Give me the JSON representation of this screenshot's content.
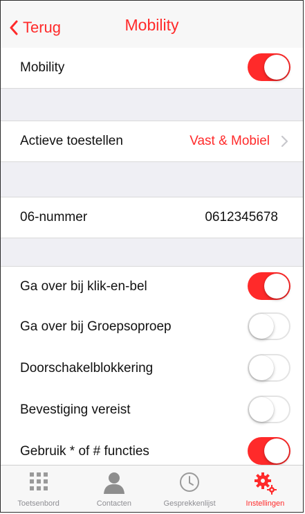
{
  "navbar": {
    "back_label": "Terug",
    "title": "Mobility"
  },
  "rows": {
    "mobility": {
      "label": "Mobility",
      "toggle": true
    },
    "devices": {
      "label": "Actieve toestellen",
      "value": "Vast & Mobiel"
    },
    "number": {
      "label": "06-nummer",
      "value": "0612345678"
    },
    "click_to_call": {
      "label": "Ga over bij klik-en-bel",
      "toggle": true
    },
    "group_call": {
      "label": "Ga over bij Groepsoproep",
      "toggle": false
    },
    "forward_block": {
      "label": "Doorschakelblokkering",
      "toggle": false
    },
    "confirm": {
      "label": "Bevestiging vereist",
      "toggle": false
    },
    "functions": {
      "label": "Gebruik * of # functies",
      "toggle": true
    }
  },
  "tabbar": {
    "tabs": [
      {
        "label": "Toetsenbord",
        "icon": "keypad-icon",
        "active": false
      },
      {
        "label": "Contacten",
        "icon": "contact-person-icon",
        "active": false
      },
      {
        "label": "Gesprekkenlijst",
        "icon": "clock-icon",
        "active": false
      },
      {
        "label": "Instellingen",
        "icon": "gears-icon",
        "active": true
      }
    ]
  },
  "colors": {
    "accent": "#ff2a2a",
    "toggle_off_border": "#e3e3e3",
    "group_bg": "#efeff4"
  }
}
